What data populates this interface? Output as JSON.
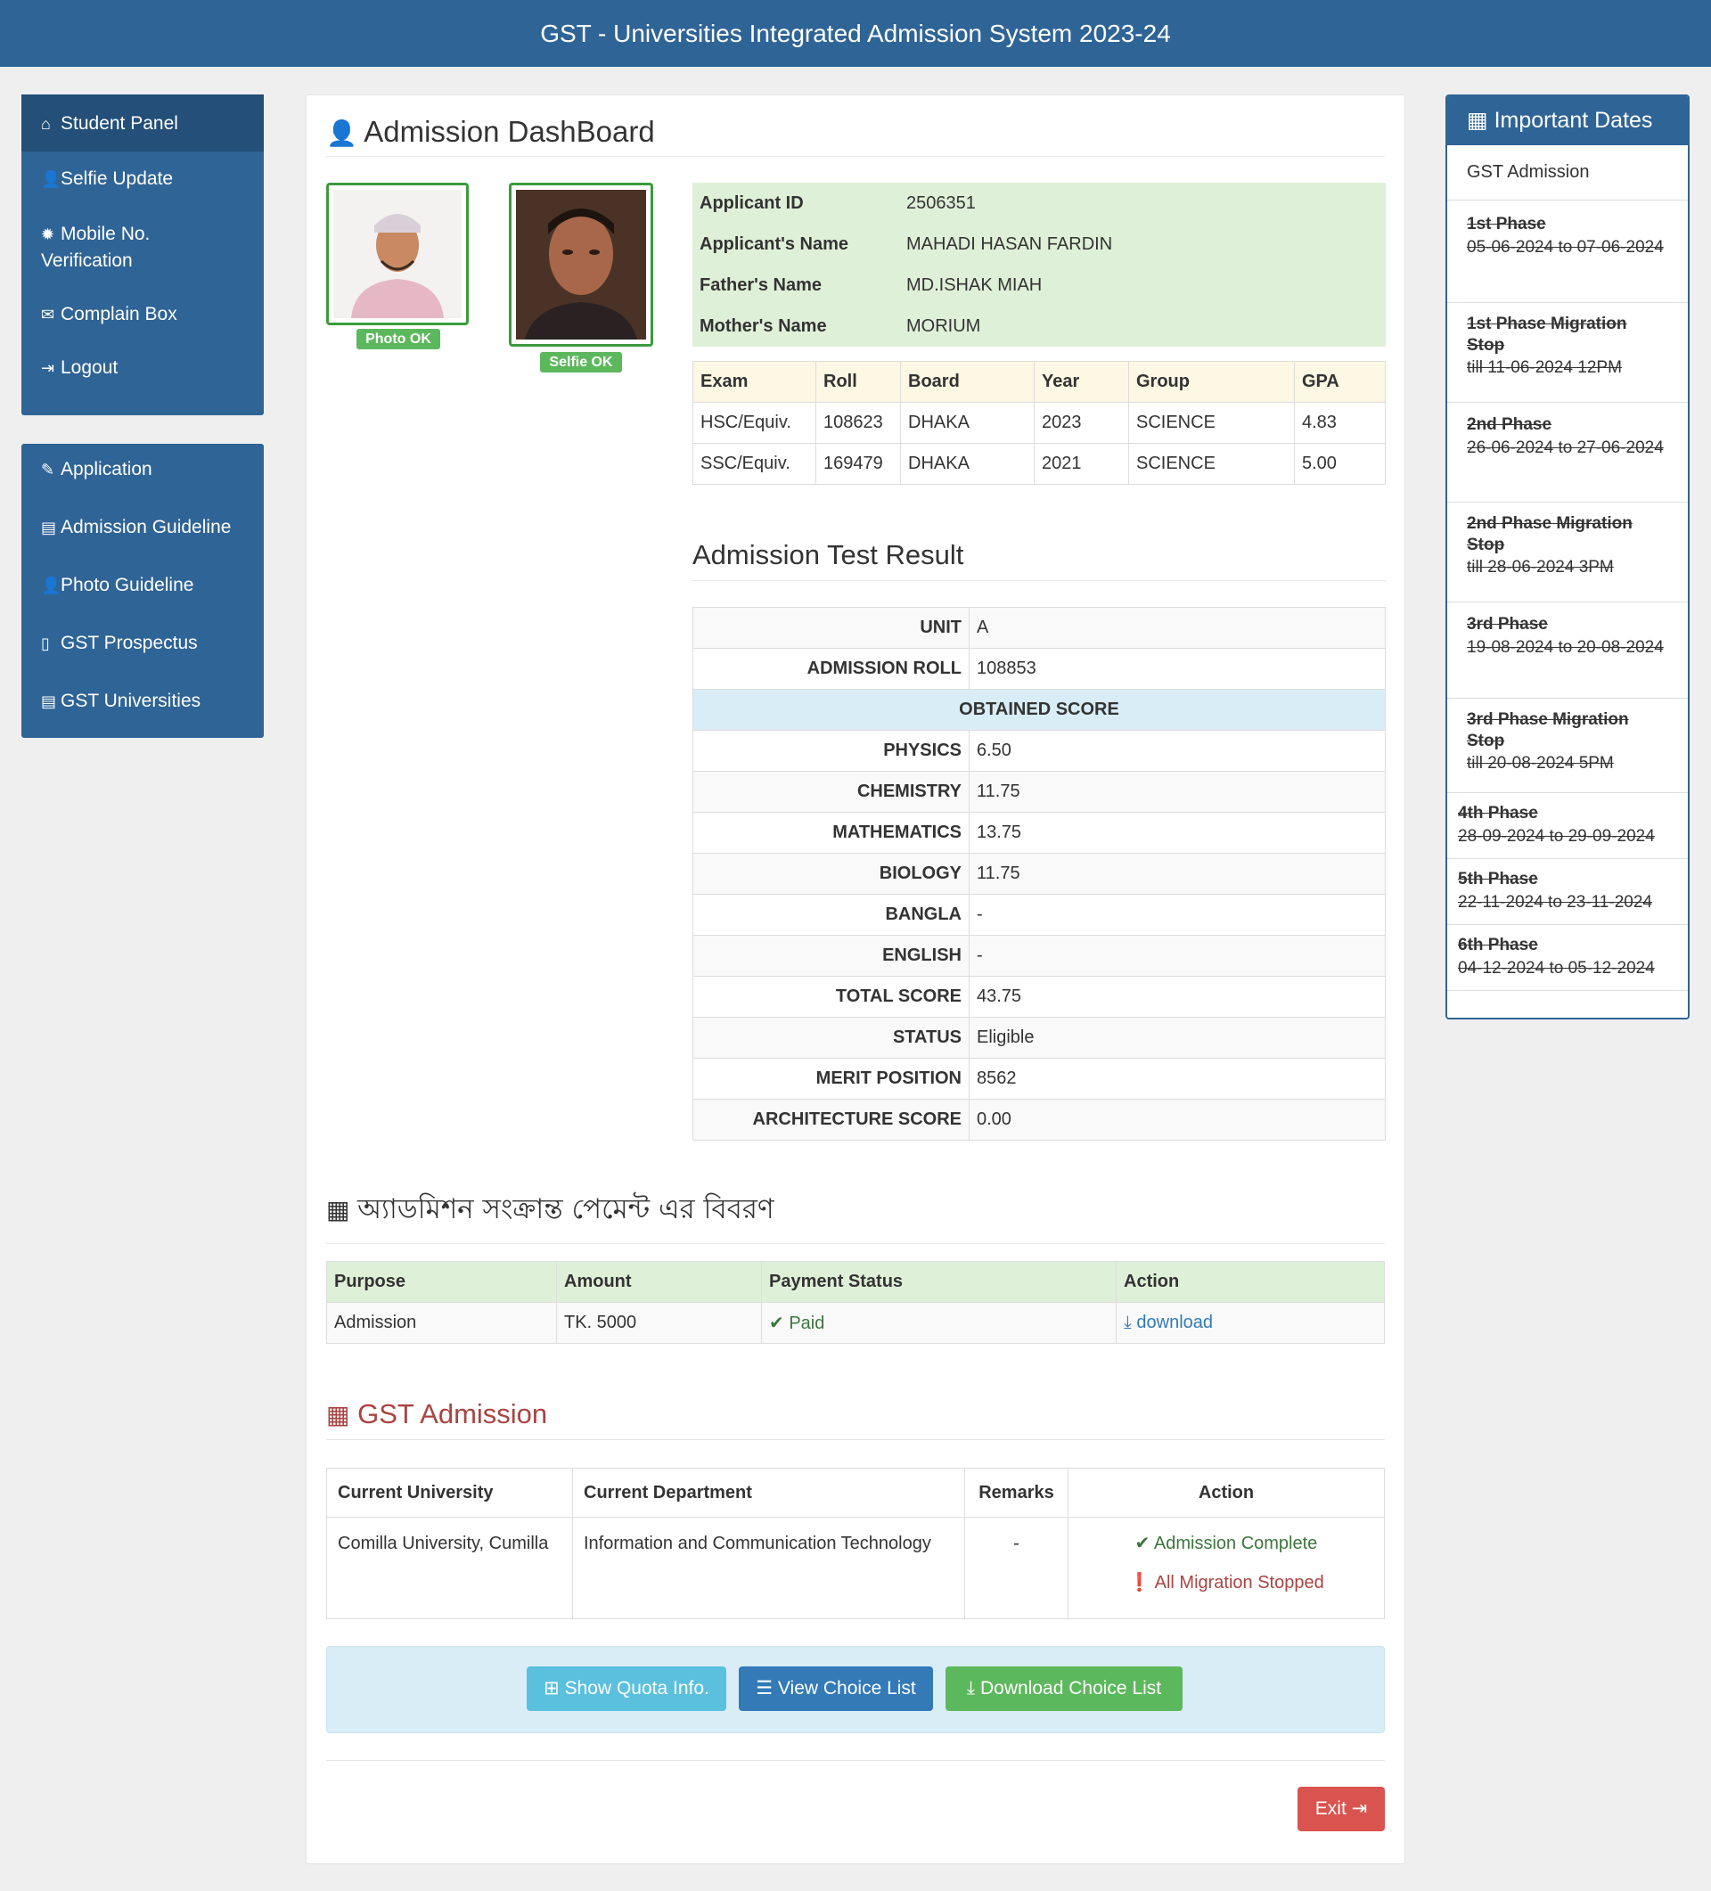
{
  "header": {
    "title": "GST - Universities Integrated Admission System 2023-24"
  },
  "sidebar": {
    "panel1": [
      {
        "icon": "home-icon",
        "label": "Student Panel"
      },
      {
        "icon": "user-icon",
        "label": "Selfie Update"
      },
      {
        "icon": "gear-icon",
        "label": "Mobile No. Verification"
      },
      {
        "icon": "envelope-icon",
        "label": "Complain Box"
      },
      {
        "icon": "logout-icon",
        "label": "Logout"
      }
    ],
    "panel2": [
      {
        "icon": "edit-icon",
        "label": "Application"
      },
      {
        "icon": "book-icon",
        "label": "Admission Guideline"
      },
      {
        "icon": "user-icon",
        "label": "Photo Guideline"
      },
      {
        "icon": "file-icon",
        "label": "GST Prospectus"
      },
      {
        "icon": "book-icon",
        "label": "GST Universities"
      }
    ]
  },
  "dashboard": {
    "title": "Admission DashBoard",
    "photo_badge": "Photo OK",
    "selfie_badge": "Selfie OK",
    "applicant": [
      {
        "k": "Applicant ID",
        "v": "2506351"
      },
      {
        "k": "Applicant's Name",
        "v": "MAHADI HASAN FARDIN"
      },
      {
        "k": "Father's Name",
        "v": "MD.ISHAK MIAH"
      },
      {
        "k": "Mother's Name",
        "v": "MORIUM"
      }
    ],
    "exam_headers": [
      "Exam",
      "Roll",
      "Board",
      "Year",
      "Group",
      "GPA"
    ],
    "exams": [
      [
        "HSC/Equiv.",
        "108623",
        "DHAKA",
        "2023",
        "SCIENCE",
        "4.83"
      ],
      [
        "SSC/Equiv.",
        "169479",
        "DHAKA",
        "2021",
        "SCIENCE",
        "5.00"
      ]
    ]
  },
  "result": {
    "title": "Admission Test Result",
    "unit_label": "UNIT",
    "unit": "A",
    "roll_label": "ADMISSION ROLL",
    "roll": "108853",
    "score_header": "OBTAINED SCORE",
    "rows": [
      {
        "k": "PHYSICS",
        "v": "6.50"
      },
      {
        "k": "CHEMISTRY",
        "v": "11.75"
      },
      {
        "k": "MATHEMATICS",
        "v": "13.75"
      },
      {
        "k": "BIOLOGY",
        "v": "11.75"
      },
      {
        "k": "BANGLA",
        "v": "-"
      },
      {
        "k": "ENGLISH",
        "v": "-"
      },
      {
        "k": "TOTAL SCORE",
        "v": "43.75"
      },
      {
        "k": "STATUS",
        "v": "Eligible"
      },
      {
        "k": "MERIT POSITION",
        "v": "8562"
      },
      {
        "k": "ARCHITECTURE SCORE",
        "v": "0.00"
      }
    ]
  },
  "payment": {
    "title": "অ্যাডমিশন সংক্রান্ত পেমেন্ট এর বিবরণ",
    "headers": [
      "Purpose",
      "Amount",
      "Payment Status",
      "Action"
    ],
    "purpose": "Admission",
    "amount": "TK. 5000",
    "status": "Paid",
    "action": "download"
  },
  "gst": {
    "title": "GST Admission",
    "headers": [
      "Current University",
      "Current Department",
      "Remarks",
      "Action"
    ],
    "university": "Comilla University, Cumilla",
    "department": "Information and Communication Technology",
    "remarks": "-",
    "action1": "Admission Complete",
    "action2": "All Migration Stopped"
  },
  "buttons": {
    "quota": "Show Quota Info.",
    "view_choice": "View Choice List",
    "download_choice": "Download Choice List",
    "exit": "Exit"
  },
  "dates": {
    "title": "Important Dates",
    "first": "GST Admission",
    "items": [
      {
        "t": "1st Phase",
        "d": "05-06-2024 to 07-06-2024"
      },
      {
        "t": "1st Phase Migration Stop",
        "d": "till 11-06-2024 12PM"
      },
      {
        "t": "2nd Phase",
        "d": "26-06-2024 to 27-06-2024"
      },
      {
        "t": "2nd Phase Migration Stop",
        "d": "till 28-06-2024 3PM"
      },
      {
        "t": "3rd Phase",
        "d": "19-08-2024 to 20-08-2024"
      },
      {
        "t": "3rd Phase Migration Stop",
        "d": "till 20-08-2024 5PM"
      },
      {
        "t": "4th Phase",
        "d": "28-09-2024 to 29-09-2024"
      },
      {
        "t": "5th Phase",
        "d": "22-11-2024 to 23-11-2024"
      },
      {
        "t": "6th Phase",
        "d": "04-12-2024 to 05-12-2024"
      }
    ]
  },
  "colors": {
    "brand": "#2f6496",
    "success": "#5cb85c",
    "danger": "#d9534f",
    "info": "#5bc0de"
  }
}
